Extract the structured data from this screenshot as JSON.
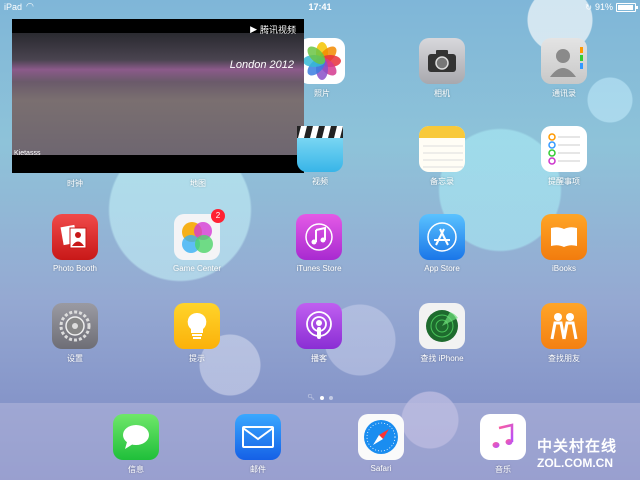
{
  "status_bar": {
    "carrier": "iPad",
    "time": "17:41",
    "battery_text": "91%",
    "battery_level": 0.91
  },
  "video": {
    "brand": "腾讯视频",
    "caption": "Kietasss",
    "banner": "London 2012"
  },
  "apps": [
    {
      "id": "clock",
      "label": "时钟",
      "icon": "clock-icon"
    },
    {
      "id": "maps",
      "label": "地图",
      "icon": "maps-icon"
    },
    {
      "id": "photos",
      "label": "照片",
      "icon": "photos-icon"
    },
    {
      "id": "videos",
      "label": "视频",
      "icon": "videos-icon"
    },
    {
      "id": "camera",
      "label": "相机",
      "icon": "camera-icon"
    },
    {
      "id": "notes",
      "label": "备忘录",
      "icon": "notes-icon"
    },
    {
      "id": "contacts",
      "label": "通讯录",
      "icon": "contacts-icon"
    },
    {
      "id": "reminders",
      "label": "提醒事项",
      "icon": "reminders-icon"
    },
    {
      "id": "photo-booth",
      "label": "Photo Booth",
      "icon": "photo-booth-icon"
    },
    {
      "id": "game-center",
      "label": "Game Center",
      "icon": "game-center-icon",
      "badge": "2"
    },
    {
      "id": "itunes-store",
      "label": "iTunes Store",
      "icon": "itunes-store-icon"
    },
    {
      "id": "app-store",
      "label": "App Store",
      "icon": "app-store-icon"
    },
    {
      "id": "ibooks",
      "label": "iBooks",
      "icon": "ibooks-icon"
    },
    {
      "id": "settings",
      "label": "设置",
      "icon": "settings-icon"
    },
    {
      "id": "tips",
      "label": "提示",
      "icon": "tips-icon"
    },
    {
      "id": "podcasts",
      "label": "播客",
      "icon": "podcasts-icon"
    },
    {
      "id": "find-iphone",
      "label": "查找 iPhone",
      "icon": "find-iphone-icon"
    },
    {
      "id": "find-friends",
      "label": "查找朋友",
      "icon": "find-friends-icon"
    }
  ],
  "dock": [
    {
      "id": "messages",
      "label": "信息",
      "icon": "messages-icon"
    },
    {
      "id": "mail",
      "label": "邮件",
      "icon": "mail-icon"
    },
    {
      "id": "safari",
      "label": "Safari",
      "icon": "safari-icon"
    },
    {
      "id": "music",
      "label": "音乐",
      "icon": "music-icon"
    }
  ],
  "page_indicator": {
    "pages": 2,
    "current": 1
  },
  "watermark": {
    "cn": "中关村在线",
    "en": "ZOL.COM.CN"
  }
}
